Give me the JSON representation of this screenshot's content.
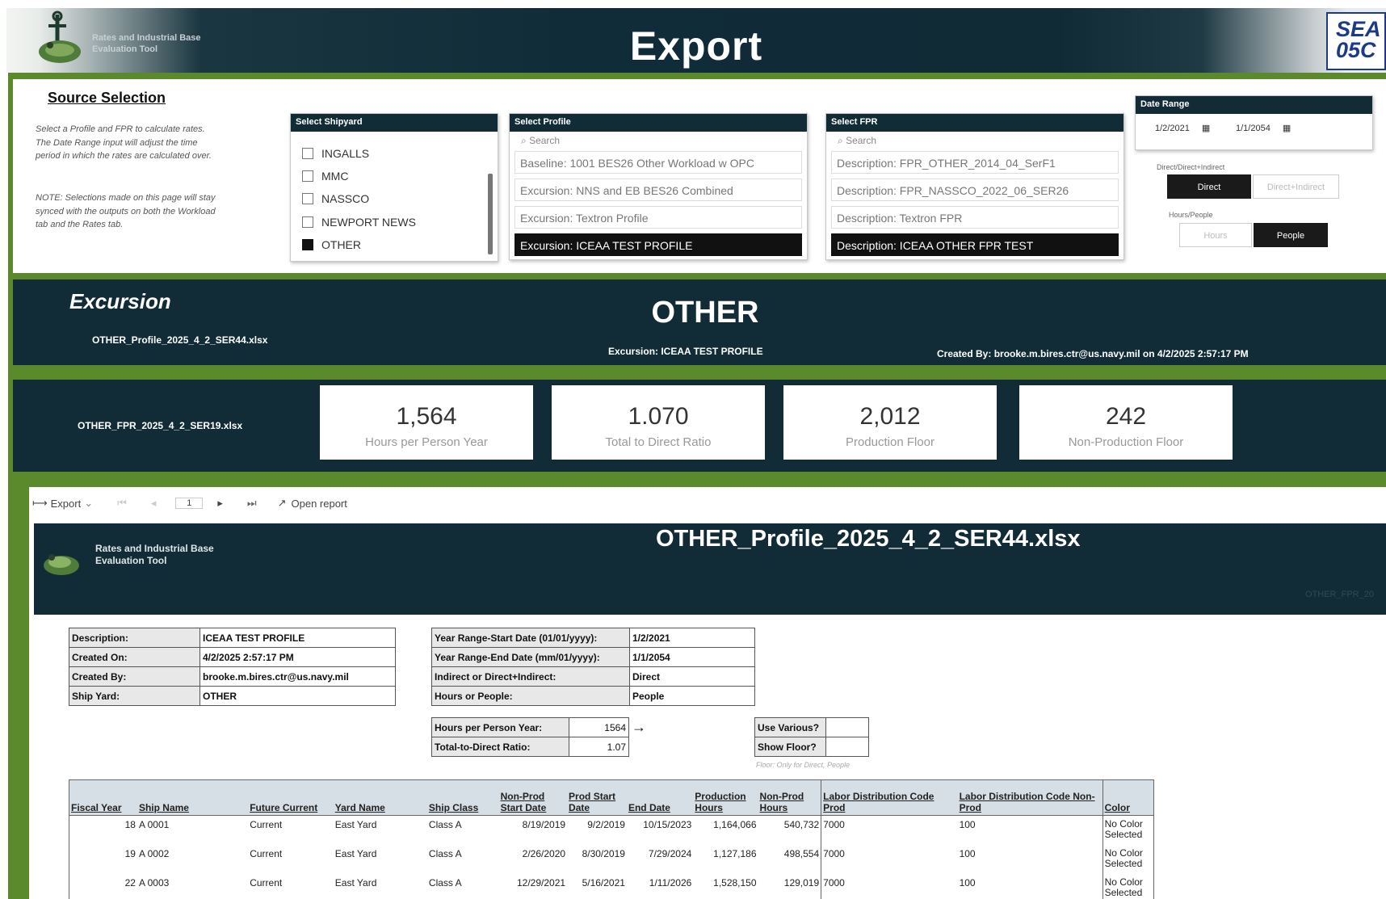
{
  "header": {
    "title": "Export",
    "logo_text": "Rates and Industrial Base Evaluation Tool",
    "badge_text": "SEA 05C"
  },
  "source": {
    "title": "Source Selection",
    "description": "Select a Profile and FPR to calculate rates. The Date Range input will adjust the time period in which the rates are calculated over.",
    "note": "NOTE: Selections made on this page will stay synced with the outputs on both the Workload tab and the Rates tab."
  },
  "shipyard": {
    "header": "Select Shipyard",
    "items": [
      {
        "label": "INGALLS",
        "checked": false
      },
      {
        "label": "MMC",
        "checked": false
      },
      {
        "label": "NASSCO",
        "checked": false
      },
      {
        "label": "NEWPORT NEWS",
        "checked": false
      },
      {
        "label": "OTHER",
        "checked": true
      }
    ]
  },
  "profile": {
    "header": "Select Profile",
    "search": "Search",
    "items": [
      {
        "label": "Baseline: 1001 BES26 Other Workload w OPC",
        "selected": false
      },
      {
        "label": "Excursion: NNS and EB BES26 Combined",
        "selected": false
      },
      {
        "label": "Excursion: Textron Profile",
        "selected": false
      },
      {
        "label": "Excursion: ICEAA TEST PROFILE",
        "selected": true
      }
    ]
  },
  "fpr": {
    "header": "Select FPR",
    "search": "Search",
    "items": [
      {
        "label": "Description: FPR_OTHER_2014_04_SerF1",
        "selected": false
      },
      {
        "label": "Description: FPR_NASSCO_2022_06_SER26",
        "selected": false
      },
      {
        "label": "Description: Textron FPR",
        "selected": false
      },
      {
        "label": "Description: ICEAA OTHER FPR TEST",
        "selected": true
      }
    ]
  },
  "date_range": {
    "header": "Date Range",
    "start": "1/2/2021",
    "end": "1/1/2054",
    "dd_label": "Direct/Direct+Indirect",
    "dd_options": [
      "Direct",
      "Direct+Indirect"
    ],
    "dd_selected": "Direct",
    "hp_label": "Hours/People",
    "hp_options": [
      "Hours",
      "People"
    ],
    "hp_selected": "People"
  },
  "excursion": {
    "label": "Excursion",
    "file": "OTHER_Profile_2025_4_2_SER44.xlsx",
    "shipyard": "OTHER",
    "profile": "Excursion: ICEAA TEST PROFILE",
    "created": "Created By: brooke.m.bires.ctr@us.navy.mil on 4/2/2025 2:57:17 PM",
    "fpr_file": "OTHER_FPR_2025_4_2_SER19.xlsx"
  },
  "kpis": [
    {
      "value": "1,564",
      "label": "Hours per Person Year"
    },
    {
      "value": "1.070",
      "label": "Total to Direct Ratio"
    },
    {
      "value": "2,012",
      "label": "Production Floor"
    },
    {
      "value": "242",
      "label": "Non-Production Floor"
    }
  ],
  "toolbar": {
    "export": "Export",
    "page": "1",
    "open": "Open report"
  },
  "report": {
    "logo_text": "Rates and Industrial Base Evaluation Tool",
    "title": "OTHER_Profile_2025_4_2_SER44.xlsx",
    "side": "OTHER_FPR_20",
    "info": [
      [
        "Description:",
        "ICEAA TEST PROFILE"
      ],
      [
        "Created On:",
        "4/2/2025 2:57:17 PM"
      ],
      [
        "Created By:",
        "brooke.m.bires.ctr@us.navy.mil"
      ],
      [
        "Ship Yard:",
        "OTHER"
      ]
    ],
    "range": [
      [
        "Year Range-Start Date (01/01/yyyy):",
        "1/2/2021"
      ],
      [
        "Year Range-End Date (mm/01/yyyy):",
        "1/1/2054"
      ],
      [
        "Indirect or Direct+Indirect:",
        "Direct"
      ],
      [
        "Hours or People:",
        "People"
      ]
    ],
    "hpy": [
      [
        "Hours per Person Year:",
        "1564"
      ],
      [
        "Total-to-Direct Ratio:",
        "1.07"
      ]
    ],
    "use": [
      [
        "Use Various?",
        ""
      ],
      [
        "Show Floor?",
        ""
      ]
    ],
    "floor_note": "Floor: Only for Direct, People",
    "columns": [
      "Fiscal Year",
      "Ship Name",
      "Future Current",
      "Yard Name",
      "Ship Class",
      "Non-Prod Start Date",
      "Prod Start Date",
      "End Date",
      "Production Hours",
      "Non-Prod Hours",
      "Labor Distribution Code Prod",
      "Labor Distribution Code Non-Prod",
      "Color"
    ],
    "rows": [
      [
        "18",
        "A 0001",
        "Current",
        "East Yard",
        "Class A",
        "8/19/2019",
        "9/2/2019",
        "10/15/2023",
        "1,164,066",
        "540,732",
        "7000",
        "100",
        "No Color Selected"
      ],
      [
        "19",
        "A 0002",
        "Current",
        "East Yard",
        "Class A",
        "2/26/2020",
        "8/30/2019",
        "7/29/2024",
        "1,127,186",
        "498,554",
        "7000",
        "100",
        "No Color Selected"
      ],
      [
        "22",
        "A 0003",
        "Current",
        "East Yard",
        "Class A",
        "12/29/2021",
        "5/16/2021",
        "1/11/2026",
        "1,528,150",
        "129,019",
        "7000",
        "100",
        "No Color Selected"
      ]
    ]
  }
}
